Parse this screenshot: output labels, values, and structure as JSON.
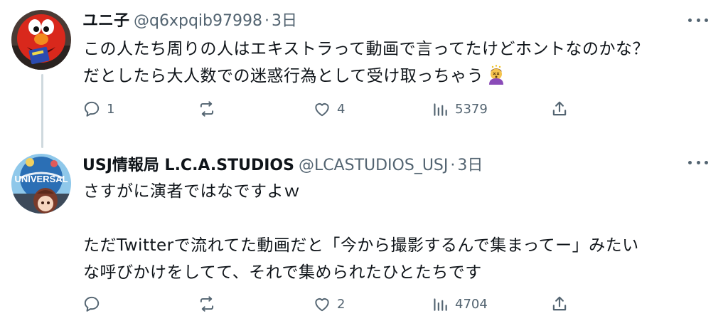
{
  "tweets": [
    {
      "author": {
        "name": "ユニ子",
        "handle": "@q6xpqib97998"
      },
      "separator": "·",
      "time": "3日",
      "lines": [
        "この人たち周りの人はエキストラって動画で言ってたけどホントなのかな？",
        "だとしたら大人数での迷惑行為として受け取っちゃう"
      ],
      "emoji": "dizzy-face-person-icon",
      "stats": {
        "replies": "1",
        "retweets": "",
        "likes": "4",
        "views": "5379"
      }
    },
    {
      "author": {
        "name": "USJ情報局 L.C.A.STUDIOS",
        "handle": "@LCASTUDIOS_USJ"
      },
      "separator": "·",
      "time": "3日",
      "lines": [
        "さすがに演者ではなですよｗ",
        "",
        "ただTwitterで流れてた動画だと「今から撮影するんで集まってー」みたい",
        "な呼びかけをしてて、それで集められたひとたちです"
      ],
      "stats": {
        "replies": "",
        "retweets": "",
        "likes": "2",
        "views": "4704"
      }
    }
  ],
  "colors": {
    "text": "#0f1419",
    "secondary": "#536471",
    "thread_line": "#cfd9de"
  }
}
